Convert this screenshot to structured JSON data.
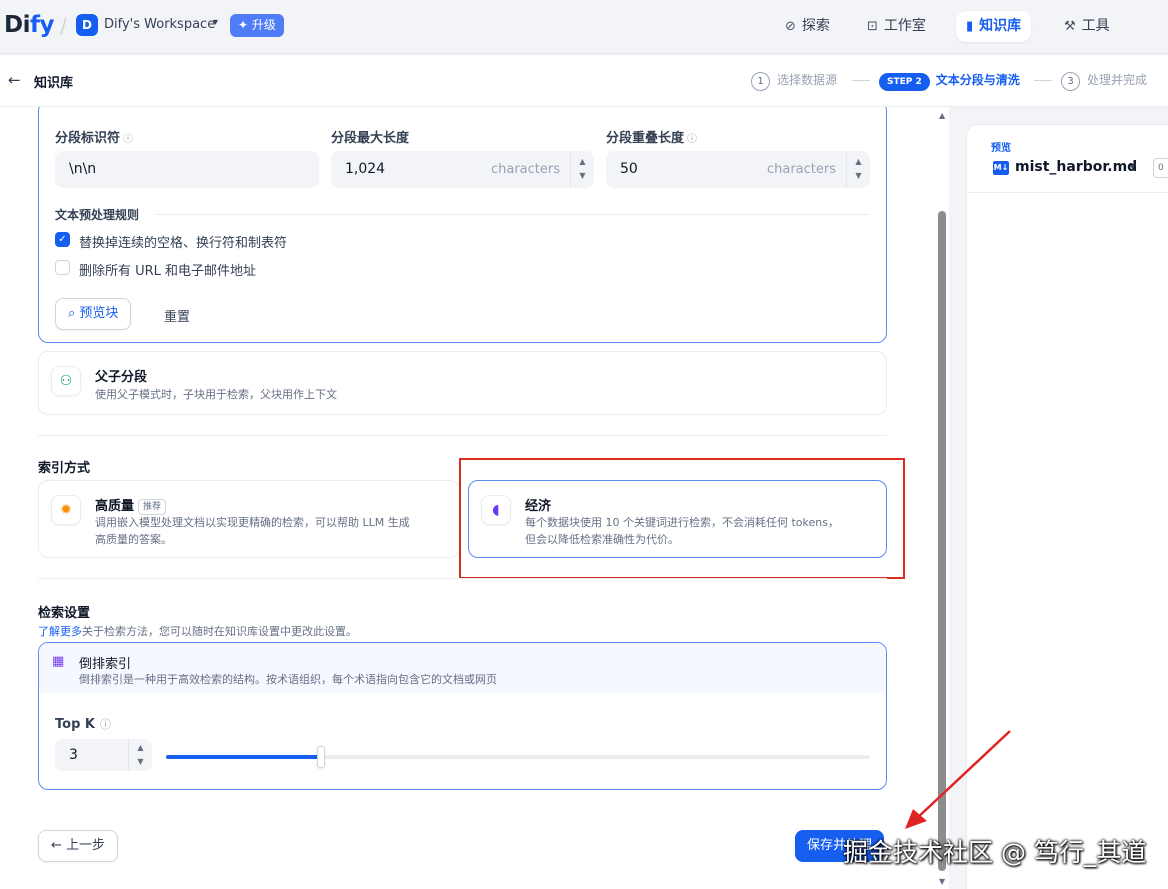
{
  "nav": {
    "logo_main": "Di",
    "logo_accent": "fy",
    "workspace_initial": "D",
    "workspace_name": "Dify's Workspace",
    "upgrade": "✦ 升级",
    "items": [
      {
        "label": "探索",
        "icon": "compass-icon"
      },
      {
        "label": "工作室",
        "icon": "robot-icon"
      },
      {
        "label": "知识库",
        "icon": "book-icon"
      },
      {
        "label": "工具",
        "icon": "hammer-icon"
      }
    ]
  },
  "header": {
    "title": "知识库",
    "steps": [
      {
        "num": "1",
        "label": "选择数据源"
      },
      {
        "pill": "STEP 2",
        "label": "文本分段与清洗"
      },
      {
        "num": "3",
        "label": "处理并完成"
      }
    ]
  },
  "segment": {
    "delimiter_label": "分段标识符",
    "delimiter_value": "\\n\\n",
    "max_len_label": "分段最大长度",
    "max_len_value": "1,024",
    "overlap_label": "分段重叠长度",
    "overlap_value": "50",
    "unit": "characters",
    "rules_title": "文本预处理规则",
    "rules": [
      {
        "label": "替换掉连续的空格、换行符和制表符",
        "checked": true
      },
      {
        "label": "删除所有 URL 和电子邮件地址",
        "checked": false
      }
    ],
    "preview_btn": "预览块",
    "reset_btn": "重置"
  },
  "parent_child": {
    "title": "父子分段",
    "desc": "使用父子模式时，子块用于检索，父块用作上下文"
  },
  "index": {
    "title": "索引方式",
    "high_title": "高质量",
    "high_tag": "推荐",
    "high_desc_1": "调用嵌入模型处理文档以实现更精确的检索，可以帮助 LLM 生成",
    "high_desc_2": "高质量的答案。",
    "eco_title": "经济",
    "eco_desc_1": "每个数据块使用 10 个关键词进行检索，不会消耗任何 tokens，",
    "eco_desc_2": "但会以降低检索准确性为代价。"
  },
  "retrieval": {
    "title": "检索设置",
    "learn_link": "了解更多",
    "learn_rest": "关于检索方法，您可以随时在知识库设置中更改此设置。",
    "method_title": "倒排索引",
    "method_desc": "倒排索引是一种用于高效检索的结构。按术语组织，每个术语指向包含它的文档或网页",
    "topk_label": "Top K",
    "topk_value": "3",
    "topk_fraction": 0.22
  },
  "footer": {
    "prev": "← 上一步",
    "save": "保存并处理"
  },
  "preview": {
    "label": "预览",
    "md_badge": "M↓",
    "file": "mist_harbor.md",
    "count": "0"
  },
  "watermark": "掘金技术社区 @ 笃行_其道",
  "colors": {
    "accent": "#155eef",
    "highlight": "#d92d20"
  }
}
